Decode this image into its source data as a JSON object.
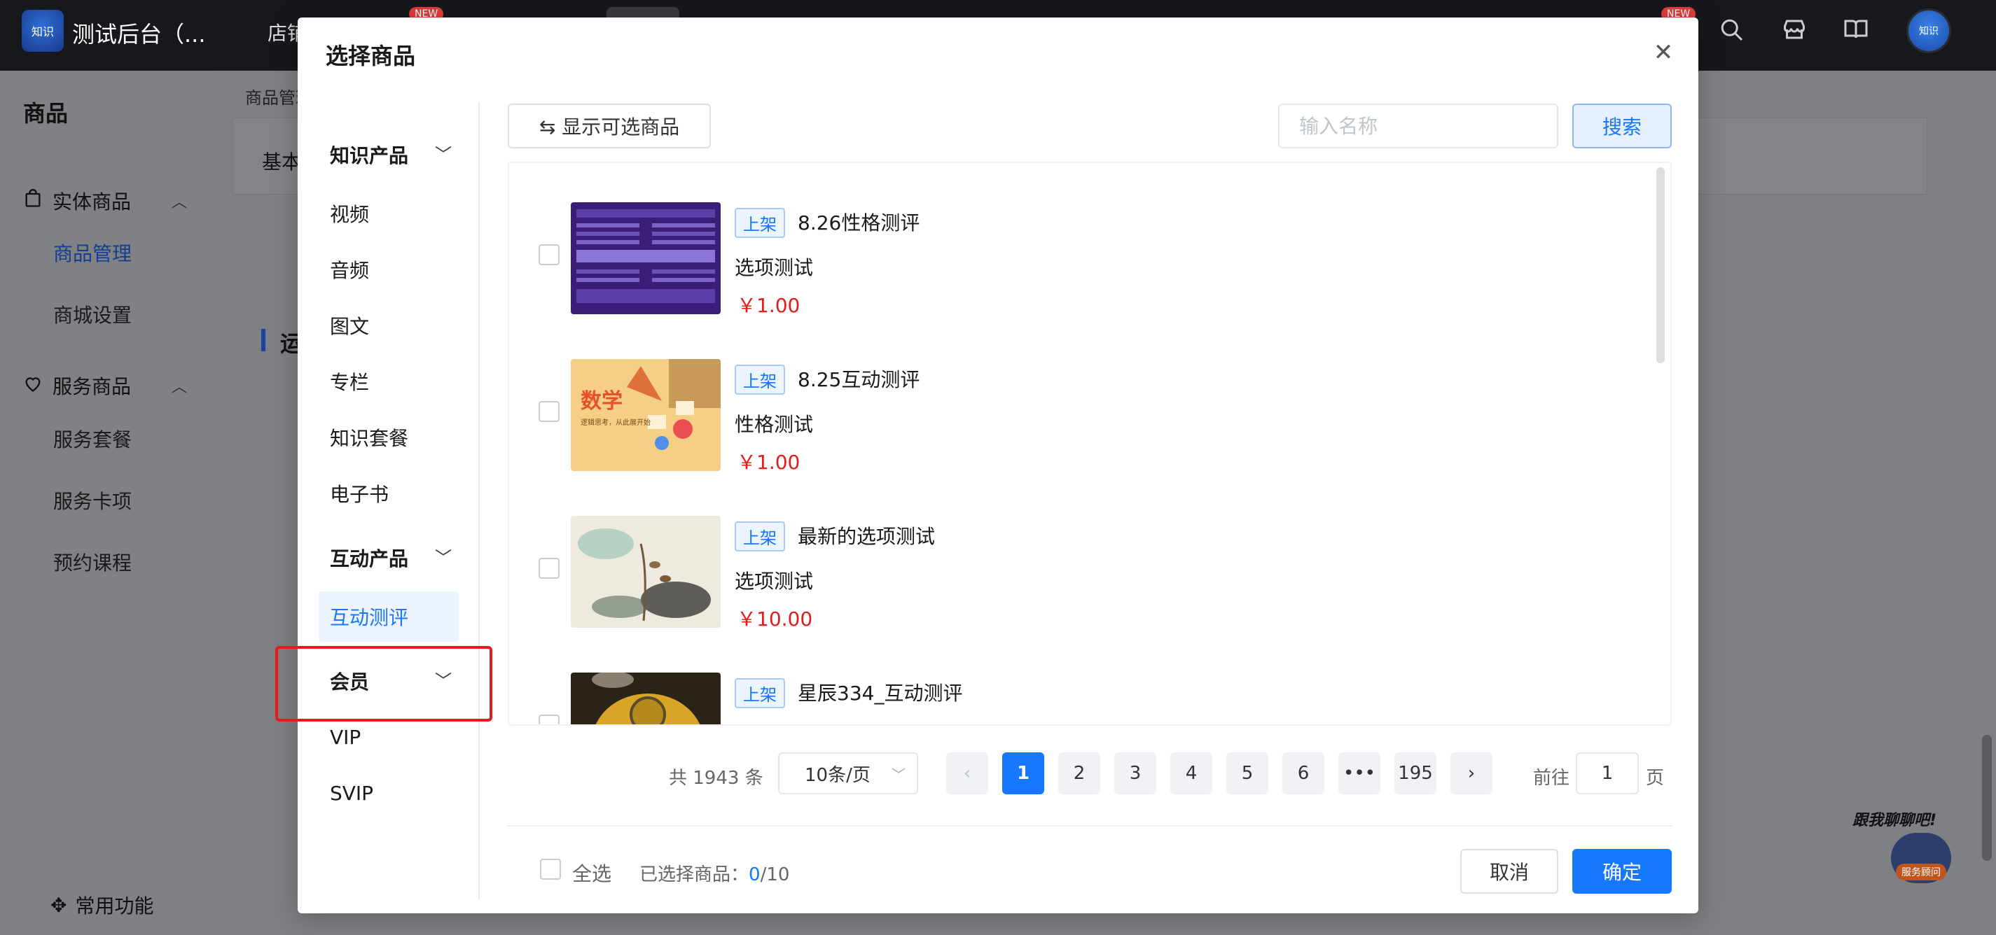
{
  "app": {
    "title": "测试后台（...",
    "nav_item": "店铺",
    "new_badge": "NEW",
    "logo_text": "知识",
    "avatar_text": "知识"
  },
  "sidebar": {
    "heading": "商品",
    "groups": [
      {
        "label": "实体商品",
        "items": [
          "商品管理",
          "商城设置"
        ]
      },
      {
        "label": "服务商品",
        "items": [
          "服务套餐",
          "服务卡项",
          "预约课程"
        ]
      }
    ],
    "active_item": "商品管理",
    "bottom": "常用功能"
  },
  "page": {
    "breadcrumb": "商品管理",
    "tab": "基本",
    "section_title": "运"
  },
  "chat": {
    "prompt": "跟我聊聊吧!",
    "badge": "服务顾问"
  },
  "modal": {
    "title": "选择商品",
    "categories": [
      {
        "group": "知识产品",
        "items": [
          "视频",
          "音频",
          "图文",
          "专栏",
          "知识套餐",
          "电子书"
        ]
      },
      {
        "group": "互动产品",
        "items": [
          "互动测评"
        ]
      },
      {
        "group": "会员",
        "items": [
          "VIP",
          "SVIP"
        ]
      }
    ],
    "active_category": "互动测评",
    "toggle_button": "⇆ 显示可选商品",
    "search_placeholder": "输入名称",
    "search_button": "搜索",
    "products": [
      {
        "tag": "上架",
        "name": "8.26性格测评",
        "sub": "选项测试",
        "price": "￥1.00"
      },
      {
        "tag": "上架",
        "name": "8.25互动测评",
        "sub": "性格测试",
        "price": "￥1.00"
      },
      {
        "tag": "上架",
        "name": "最新的选项测试",
        "sub": "选项测试",
        "price": "￥10.00"
      },
      {
        "tag": "上架",
        "name": "星辰334_互动测评",
        "sub": "",
        "price": ""
      }
    ],
    "thumb_text": {
      "math": "数学",
      "math_sub": "逻辑思考，从此展开始"
    },
    "pagination": {
      "total_text": "共 1943 条",
      "page_size": "10条/页",
      "pages": [
        "1",
        "2",
        "3",
        "4",
        "5",
        "6",
        "•••",
        "195"
      ],
      "current": "1",
      "prev": "‹",
      "next": "›",
      "goto_label": "前往",
      "goto_value": "1",
      "goto_unit": "页"
    },
    "footer": {
      "select_all": "全选",
      "selected_label": "已选择商品：",
      "selected_count": "0",
      "selected_max": "/10",
      "cancel": "取消",
      "confirm": "确定"
    }
  }
}
